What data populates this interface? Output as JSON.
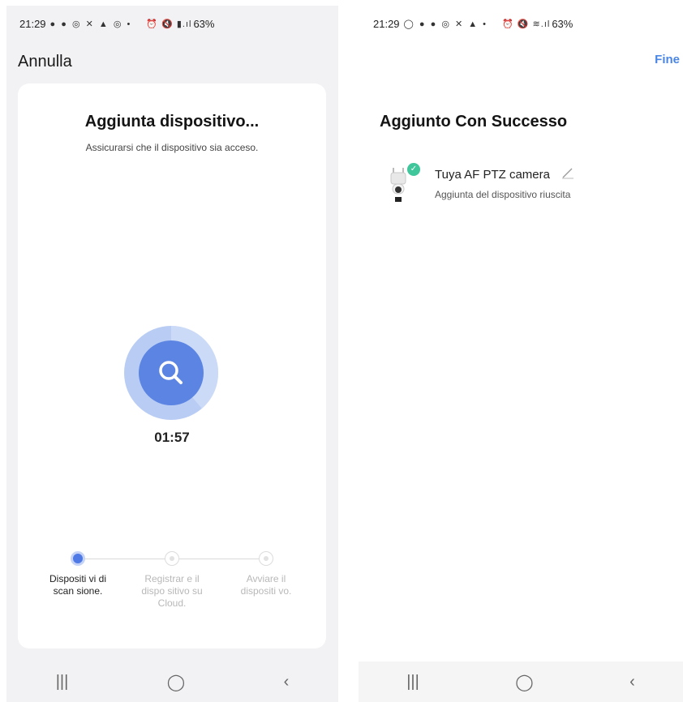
{
  "left": {
    "status_bar": {
      "time": "21:29",
      "icons": "● ● ◎ ✕ ▲ ◎ •",
      "sys_icons": "⏰ 🔇 ▮.ıl",
      "battery": "63%"
    },
    "cancel_label": "Annulla",
    "card": {
      "title": "Aggiunta dispositivo...",
      "subtitle": "Assicurarsi che il dispositivo sia acceso.",
      "timer": "01:57",
      "steps": [
        {
          "label": "Dispositi vi di scan sione.",
          "state": "active"
        },
        {
          "label": "Registrar e il dispo sitivo su Cloud.",
          "state": "inactive"
        },
        {
          "label": "Avviare il dispositi vo.",
          "state": "inactive"
        }
      ]
    },
    "nav": {
      "recents": "|||",
      "home": "◯",
      "back": "‹"
    }
  },
  "right": {
    "status_bar": {
      "time": "21:29",
      "icons": "◯ ● ● ◎ ✕ ▲ •",
      "sys_icons": "⏰ 🔇 ≋.ıl",
      "battery": "63%"
    },
    "done_label": "Fine",
    "title": "Aggiunto Con Successo",
    "device": {
      "name": "Tuya AF PTZ camera",
      "status": "Aggiunta del dispositivo riuscita"
    },
    "nav": {
      "recents": "|||",
      "home": "◯",
      "back": "‹"
    }
  },
  "colors": {
    "accent": "#4a86e6",
    "scan_outer": "#b9cdf4",
    "scan_inner": "#5b84e3",
    "success": "#3fc69a"
  }
}
